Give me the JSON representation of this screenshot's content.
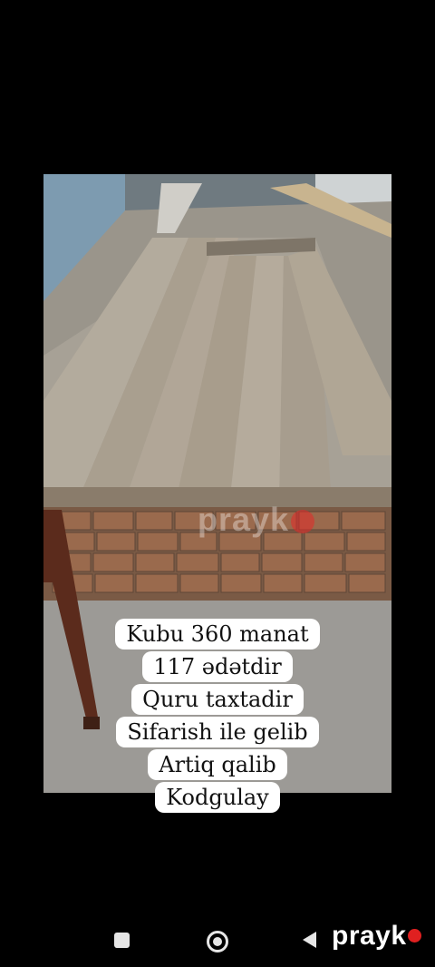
{
  "photo": {
    "caption_lines": [
      "Kubu 360 manat",
      "117 ədətdir",
      "Quru taxtadir",
      "Sifarish ile gelib",
      "Artiq qalib",
      "Kodgulay"
    ],
    "watermark": "prayk"
  },
  "navbar": {
    "icons": [
      "recents-square-icon",
      "home-circle-icon",
      "back-triangle-icon"
    ],
    "logo_text": "prayk",
    "logo_dot_color": "#e02020"
  }
}
